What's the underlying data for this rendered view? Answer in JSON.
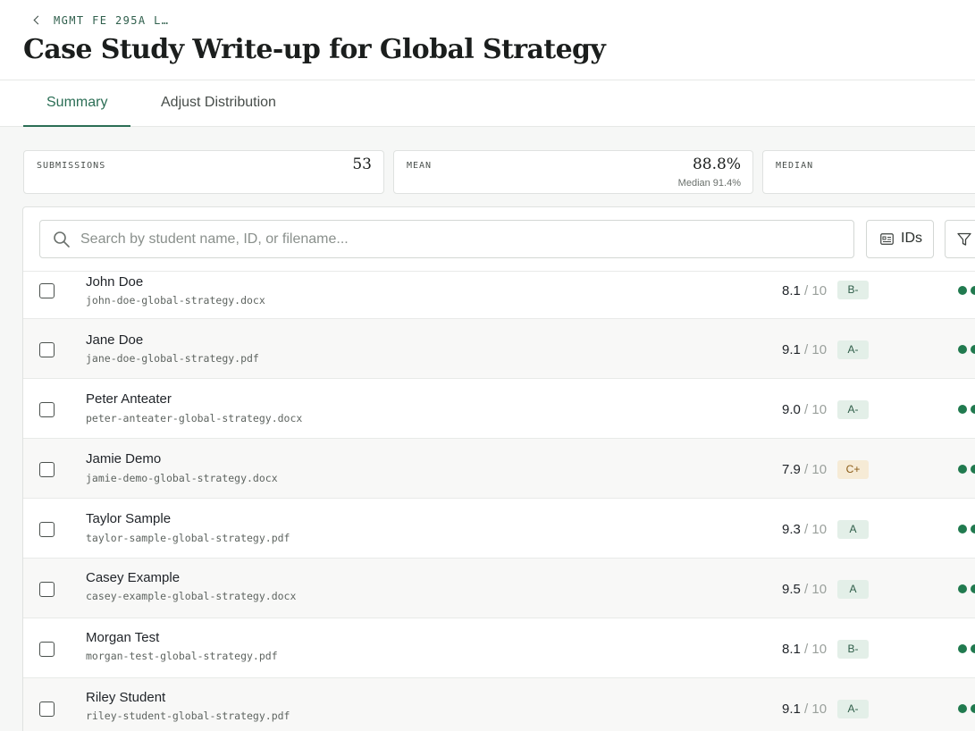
{
  "breadcrumb": {
    "label": "MGMT FE 295A L…"
  },
  "page": {
    "title": "Case Study Write-up for Global Strategy"
  },
  "tabs": [
    {
      "label": "Summary",
      "active": true
    },
    {
      "label": "Adjust Distribution",
      "active": false
    }
  ],
  "stats": {
    "submissions": {
      "label": "SUBMISSIONS",
      "value": "53"
    },
    "mean": {
      "label": "MEAN",
      "value": "88.8%",
      "sub": "Median 91.4%"
    },
    "median": {
      "label": "MEDIAN"
    }
  },
  "search": {
    "placeholder": "Search by student name, ID, or filename..."
  },
  "toolbar": {
    "ids_label": "IDs"
  },
  "colors": {
    "accent": "#2b6e55",
    "status_dot": "#217a4f",
    "grade_good_bg": "#e3efe8",
    "grade_mid_bg": "#f6ebd6"
  },
  "rows": [
    {
      "name": "John Doe",
      "file": "john-doe-global-strategy.docx",
      "score": "8.1",
      "out_of": "/ 10",
      "grade": "B-",
      "grade_tone": "good"
    },
    {
      "name": "Jane Doe",
      "file": "jane-doe-global-strategy.pdf",
      "score": "9.1",
      "out_of": "/ 10",
      "grade": "A-",
      "grade_tone": "good"
    },
    {
      "name": "Peter Anteater",
      "file": "peter-anteater-global-strategy.docx",
      "score": "9.0",
      "out_of": "/ 10",
      "grade": "A-",
      "grade_tone": "good"
    },
    {
      "name": "Jamie Demo",
      "file": "jamie-demo-global-strategy.docx",
      "score": "7.9",
      "out_of": "/ 10",
      "grade": "C+",
      "grade_tone": "mid"
    },
    {
      "name": "Taylor Sample",
      "file": "taylor-sample-global-strategy.pdf",
      "score": "9.3",
      "out_of": "/ 10",
      "grade": "A",
      "grade_tone": "good"
    },
    {
      "name": "Casey Example",
      "file": "casey-example-global-strategy.docx",
      "score": "9.5",
      "out_of": "/ 10",
      "grade": "A",
      "grade_tone": "good"
    },
    {
      "name": "Morgan Test",
      "file": "morgan-test-global-strategy.pdf",
      "score": "8.1",
      "out_of": "/ 10",
      "grade": "B-",
      "grade_tone": "good"
    },
    {
      "name": "Riley Student",
      "file": "riley-student-global-strategy.pdf",
      "score": "9.1",
      "out_of": "/ 10",
      "grade": "A-",
      "grade_tone": "good"
    }
  ]
}
